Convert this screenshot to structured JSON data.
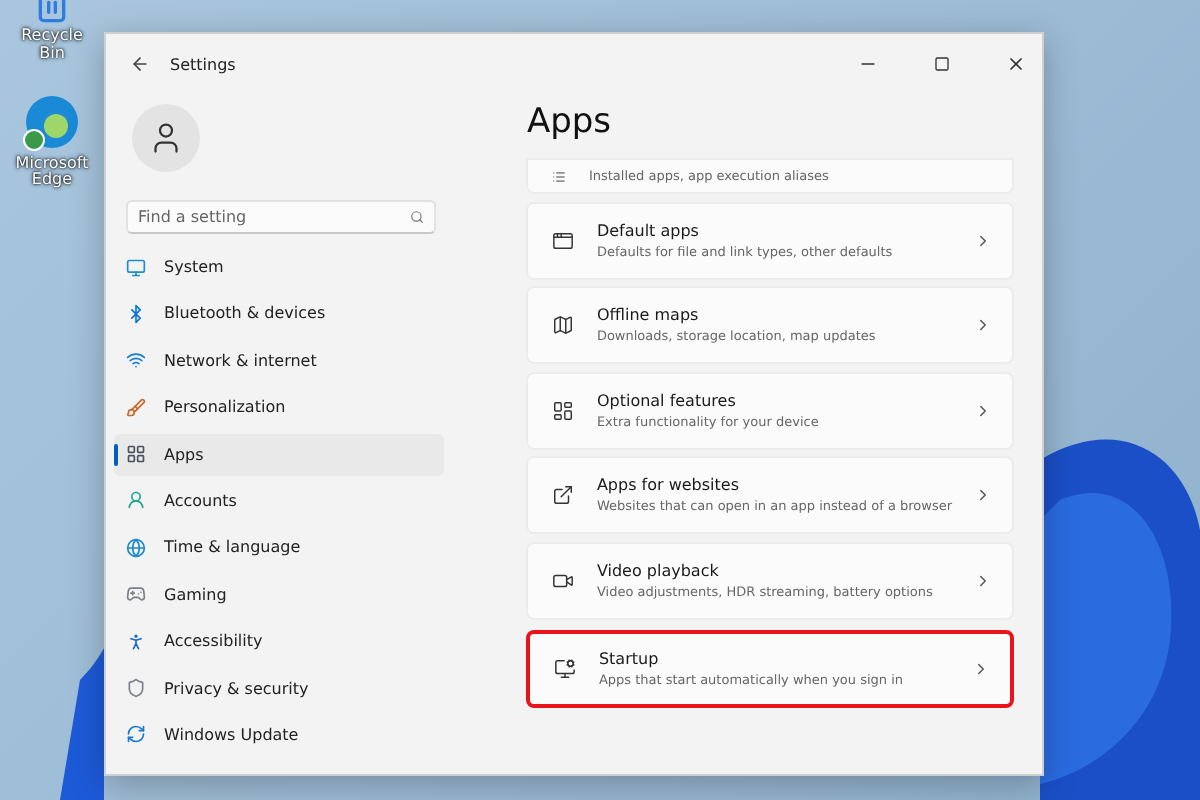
{
  "desktop_icons": [
    {
      "label": "Recycle Bin"
    },
    {
      "label": "Microsoft Edge"
    }
  ],
  "window": {
    "title": "Settings"
  },
  "sidebar": {
    "search": {
      "placeholder": "Find a setting"
    },
    "items": [
      {
        "label": "System",
        "selected": false
      },
      {
        "label": "Bluetooth & devices",
        "selected": false
      },
      {
        "label": "Network & internet",
        "selected": false
      },
      {
        "label": "Personalization",
        "selected": false
      },
      {
        "label": "Apps",
        "selected": true
      },
      {
        "label": "Accounts",
        "selected": false
      },
      {
        "label": "Time & language",
        "selected": false
      },
      {
        "label": "Gaming",
        "selected": false
      },
      {
        "label": "Accessibility",
        "selected": false
      },
      {
        "label": "Privacy & security",
        "selected": false
      },
      {
        "label": "Windows Update",
        "selected": false
      }
    ]
  },
  "content": {
    "title": "Apps",
    "cards": [
      {
        "description": "Installed apps, app execution aliases",
        "highlighted": false
      },
      {
        "title": "Default apps",
        "description": "Defaults for file and link types, other defaults",
        "highlighted": false
      },
      {
        "title": "Offline maps",
        "description": "Downloads, storage location, map updates",
        "highlighted": false
      },
      {
        "title": "Optional features",
        "description": "Extra functionality for your device",
        "highlighted": false
      },
      {
        "title": "Apps for websites",
        "description": "Websites that can open in an app instead of a browser",
        "highlighted": false
      },
      {
        "title": "Video playback",
        "description": "Video adjustments, HDR streaming, battery options",
        "highlighted": false
      },
      {
        "title": "Startup",
        "description": "Apps that start automatically when you sign in",
        "highlighted": true
      }
    ]
  }
}
